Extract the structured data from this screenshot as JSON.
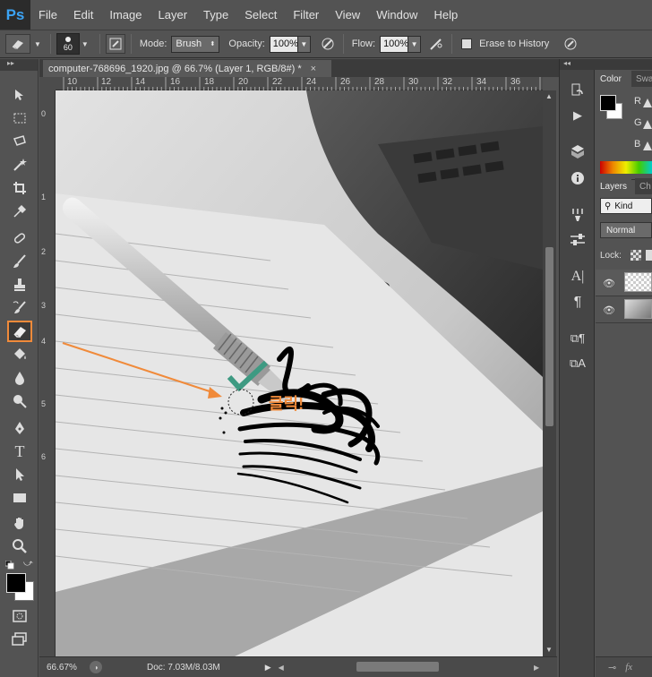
{
  "app": {
    "logo": "Ps"
  },
  "menu": [
    "File",
    "Edit",
    "Image",
    "Layer",
    "Type",
    "Select",
    "Filter",
    "View",
    "Window",
    "Help"
  ],
  "options": {
    "brush_size": "60",
    "mode_label": "Mode:",
    "mode_value": "Brush",
    "opacity_label": "Opacity:",
    "opacity_value": "100%",
    "flow_label": "Flow:",
    "flow_value": "100%",
    "erase_history_label": "Erase to History"
  },
  "document": {
    "tab_title": "computer-768696_1920.jpg @ 66.7% (Layer 1, RGB/8#) *",
    "close": "×"
  },
  "ruler_top": [
    "10",
    "12",
    "14",
    "16",
    "18",
    "20",
    "22",
    "24",
    "26",
    "28",
    "30",
    "32",
    "34",
    "36"
  ],
  "ruler_left": [
    "0",
    "1",
    "2",
    "3",
    "4",
    "5",
    "6"
  ],
  "annotation": {
    "click_text": "클릭!"
  },
  "status": {
    "zoom": "66.67%",
    "doc": "Doc: 7.03M/8.03M"
  },
  "panels": {
    "color_tab": "Color",
    "swatches_tab": "Swa",
    "rgb": [
      "R",
      "G",
      "B"
    ],
    "layers_tab": "Layers",
    "channels_tab": "Ch",
    "kind_label": "Kind",
    "blend_mode": "Normal",
    "lock_label": "Lock:"
  },
  "colors": {
    "accent": "#f08a3a",
    "check": "#3e9a82",
    "ps_blue": "#3ba3f5"
  }
}
